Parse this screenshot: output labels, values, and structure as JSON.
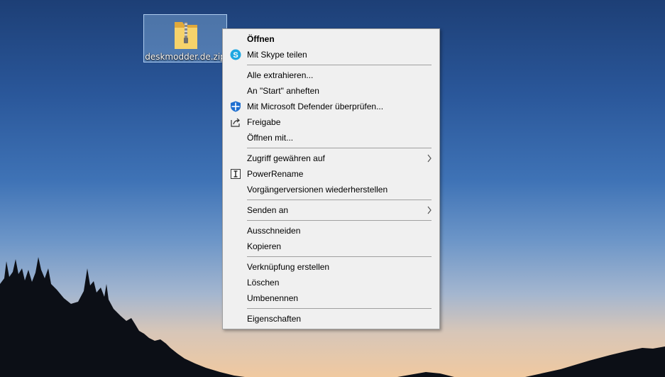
{
  "desktop": {
    "file_icon": {
      "name": "deskmodder.de.zip",
      "icon": "zip-folder-icon"
    }
  },
  "context_menu": {
    "items": [
      {
        "label": "Öffnen",
        "bold": true
      },
      {
        "label": "Mit Skype teilen",
        "icon": "skype-icon"
      },
      {
        "label": "Alle extrahieren..."
      },
      {
        "label": "An \"Start\" anheften"
      },
      {
        "label": "Mit Microsoft Defender überprüfen...",
        "icon": "defender-shield-icon"
      },
      {
        "label": "Freigabe",
        "icon": "share-icon"
      },
      {
        "label": "Öffnen mit..."
      },
      {
        "label": "Zugriff gewähren auf",
        "submenu": true
      },
      {
        "label": "PowerRename",
        "icon": "powerrename-icon"
      },
      {
        "label": "Vorgängerversionen wiederherstellen"
      },
      {
        "label": "Senden an",
        "submenu": true
      },
      {
        "label": "Ausschneiden"
      },
      {
        "label": "Kopieren"
      },
      {
        "label": "Verknüpfung erstellen"
      },
      {
        "label": "Löschen"
      },
      {
        "label": "Umbenennen"
      },
      {
        "label": "Eigenschaften"
      }
    ]
  },
  "colors": {
    "menu_bg": "#f0f0f0",
    "separator": "#a0a0a0",
    "selection": "#99c5f0"
  }
}
